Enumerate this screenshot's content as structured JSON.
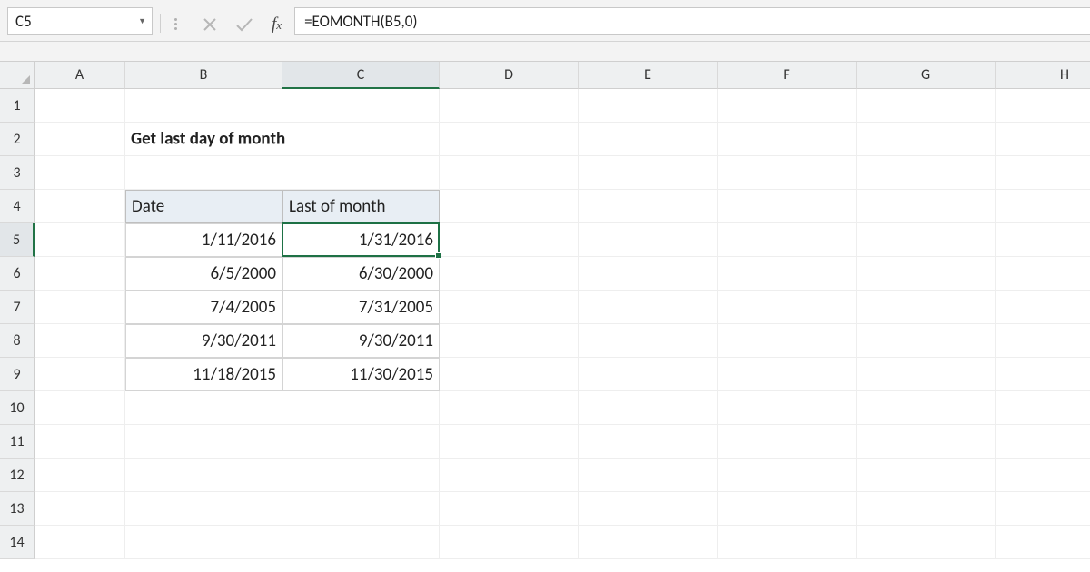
{
  "nameBox": "C5",
  "formula": "=EOMONTH(B5,0)",
  "columns": [
    "A",
    "B",
    "C",
    "D",
    "E",
    "F",
    "G",
    "H"
  ],
  "rows": [
    "1",
    "2",
    "3",
    "4",
    "5",
    "6",
    "7",
    "8",
    "9",
    "10",
    "11",
    "12",
    "13",
    "14"
  ],
  "title": "Get last day of month",
  "table": {
    "headers": {
      "date": "Date",
      "last": "Last of month"
    },
    "rows": [
      {
        "date": "1/11/2016",
        "last": "1/31/2016"
      },
      {
        "date": "6/5/2000",
        "last": "6/30/2000"
      },
      {
        "date": "7/4/2005",
        "last": "7/31/2005"
      },
      {
        "date": "9/30/2011",
        "last": "9/30/2011"
      },
      {
        "date": "11/18/2015",
        "last": "11/30/2015"
      }
    ]
  },
  "selection": {
    "cell": "C5"
  },
  "colors": {
    "selectionBorder": "#1e7145",
    "headerFill": "#e8eef4"
  }
}
